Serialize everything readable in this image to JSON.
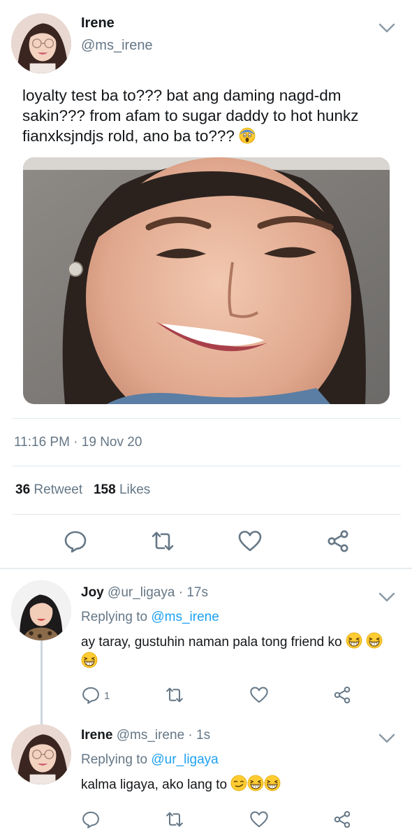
{
  "tweet": {
    "name": "Irene",
    "handle": "@ms_irene",
    "text": "loyalty test ba to??? bat ang daming nagd-dm sakin??? from afam to sugar daddy to hot hunkz fianxksjndjs rold, ano ba to???",
    "emoji": "face-screaming-in-fear",
    "timestamp": "11:16 PM · 19 Nov 20",
    "retweets": "36",
    "retweet_label": "Retweet",
    "likes": "158",
    "likes_label": "Likes"
  },
  "replies": [
    {
      "name": "Joy",
      "handle": "@ur_ligaya",
      "age": "· 17s",
      "replying_label": "Replying to",
      "replying_to": "@ms_irene",
      "text": "ay taray, gustuhin naman pala tong friend ko",
      "emojis": [
        "grinning-squinting-face",
        "grinning-squinting-face",
        "grinning-squinting-face"
      ],
      "reply_count": "1"
    },
    {
      "name": "Irene",
      "handle": "@ms_irene",
      "age": "· 1s",
      "replying_label": "Replying to",
      "replying_to": "@ur_ligaya",
      "text": "kalma ligaya, ako lang to",
      "emojis": [
        "smirking-face",
        "grinning-squinting-face",
        "grinning-squinting-face"
      ]
    }
  ],
  "icons": {
    "reply": "speech-bubble-icon",
    "retweet": "retweet-icon",
    "like": "heart-icon",
    "share": "share-icon",
    "more": "chevron-down-icon"
  },
  "colors": {
    "text": "#14171a",
    "secondary": "#657786",
    "link": "#1da1f2",
    "divider": "#e1e8ed"
  }
}
